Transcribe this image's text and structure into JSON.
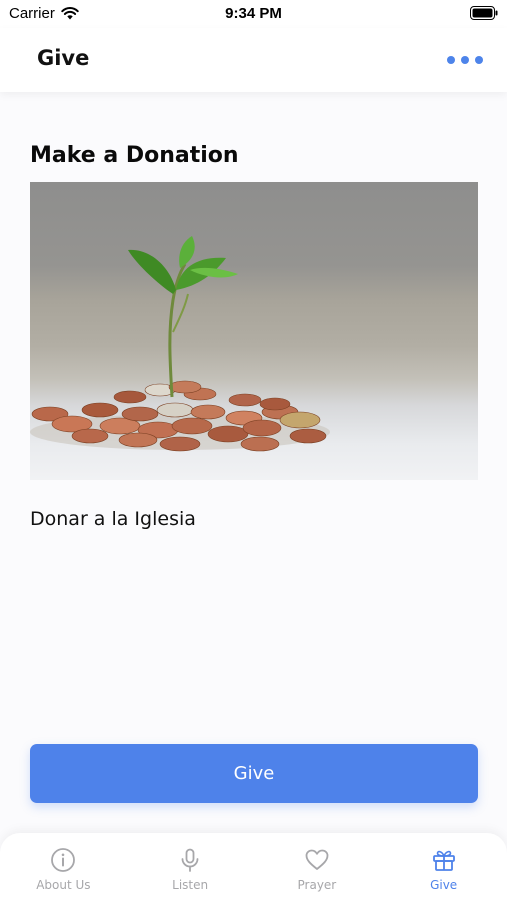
{
  "status_bar": {
    "carrier": "Carrier",
    "time": "9:34 PM"
  },
  "header": {
    "title": "Give",
    "more_icon": "ellipsis-icon"
  },
  "main": {
    "section_title": "Make a Donation",
    "image_subject": "coins-with-sprout",
    "caption": "Donar a la Iglesia",
    "give_button_label": "Give"
  },
  "tab_bar": {
    "tabs": [
      {
        "label": "About Us",
        "icon": "info-icon",
        "active": false
      },
      {
        "label": "Listen",
        "icon": "microphone-icon",
        "active": false
      },
      {
        "label": "Prayer",
        "icon": "heart-icon",
        "active": false
      },
      {
        "label": "Give",
        "icon": "gift-icon",
        "active": true
      }
    ]
  },
  "colors": {
    "accent": "#4e82ea",
    "inactive": "#a7a7aa",
    "background": "#fbfbfd"
  }
}
